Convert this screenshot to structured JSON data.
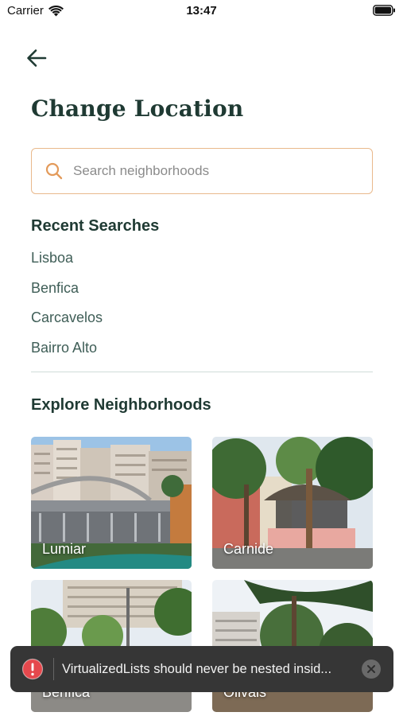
{
  "status_bar": {
    "carrier": "Carrier",
    "time": "13:47"
  },
  "header": {
    "title": "Change Location"
  },
  "search": {
    "placeholder": "Search neighborhoods",
    "value": ""
  },
  "recent": {
    "title": "Recent Searches",
    "items": [
      {
        "label": "Lisboa"
      },
      {
        "label": "Benfica"
      },
      {
        "label": "Carcavelos"
      },
      {
        "label": "Bairro Alto"
      }
    ]
  },
  "explore": {
    "title": "Explore Neighborhoods",
    "cards": [
      {
        "label": "Lumiar"
      },
      {
        "label": "Carnide"
      },
      {
        "label": "Benfica"
      },
      {
        "label": "Olivais"
      }
    ]
  },
  "toast": {
    "message": "VirtualizedLists should never be nested insid..."
  },
  "colors": {
    "primary": "#1f3a33",
    "accent": "#e9b98c",
    "link": "#3f5e57",
    "toast_bg": "#363636",
    "error": "#e5484d"
  }
}
